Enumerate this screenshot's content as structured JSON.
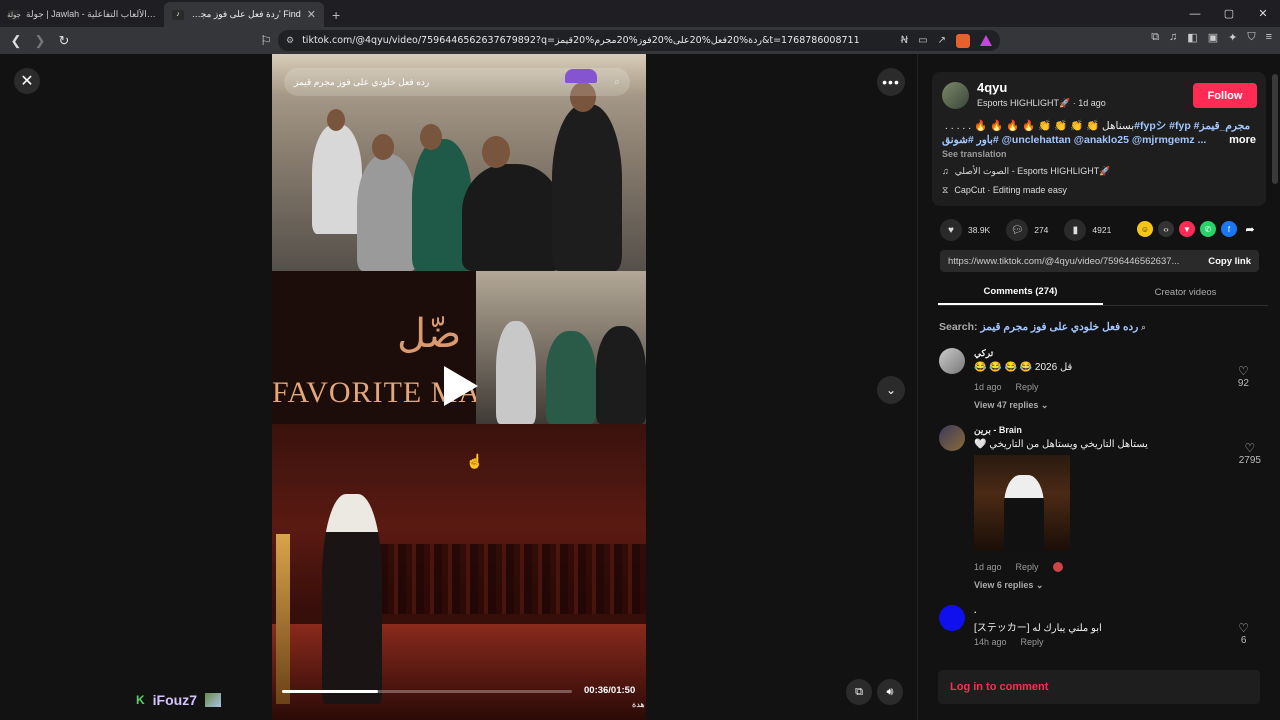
{
  "browser": {
    "tabs": [
      {
        "label": "جولة | Jawlah - منصة الألعاب التفاعلية",
        "favicon": "جولة"
      },
      {
        "label": "Find 'ردة فعل على فوز مجرم قيمز'",
        "favicon": "tiktok"
      }
    ],
    "new_tab": "+",
    "url": "tiktok.com/@4qyu/video/7596446562637679892?q=ردة%20فعل%20على%20فوز%20مجرم%20قيمز&t=1768786008711",
    "window_controls": [
      "—",
      "▢",
      "✕"
    ]
  },
  "video": {
    "search_text": "رده فعل خلودي على فوز مجرم قيمز",
    "banner_text": "FAVORITE MA",
    "banner_arabic": "ضّل",
    "current_time": "00:36",
    "duration": "01:50",
    "time_display": "00:36/01:50",
    "progress": 0.33,
    "corner_text": "هدة",
    "overlay_user": "iFouz7",
    "overlay_k": "K"
  },
  "author": {
    "username": "4qyu",
    "display": "Esports HIGHLIGHT🚀",
    "age": "· 1d ago",
    "follow_label": "Follow",
    "description_prefix": "بسناهل 👏 👏 👏 👏 🔥 🔥 🔥 🔥 . . . . . ",
    "description_tags": "#fypシ #fyp #مجرم_قيمز #باور #شونق @unclehattan @anaklo25 @mjrmgemz ...",
    "more_label": "more",
    "see_translation": "See translation",
    "music": "الصوت الأصلي - Esports HIGHLIGHT🚀",
    "capcut": "CapCut · Editing made easy"
  },
  "stats": {
    "likes": "38.9K",
    "comments": "274",
    "saves": "4921"
  },
  "share": {
    "link": "https://www.tiktok.com/@4qyu/video/7596446562637...",
    "copy_label": "Copy link"
  },
  "tabs": {
    "comments": "Comments (274)",
    "creator": "Creator videos"
  },
  "search": {
    "label": "Search:",
    "query": "رده فعل خلودي على فوز مجرم قيمز"
  },
  "comments": [
    {
      "name": "تركي",
      "text": "قل 2026 😂 😂 😂 😂",
      "age": "1d ago",
      "reply": "Reply",
      "likes": "92",
      "replies": "View 47 replies"
    },
    {
      "name": "برين - Brain",
      "text": "يستاهل التاريخي ويستاهل من التاريخي 🤍",
      "age": "1d ago",
      "reply": "Reply",
      "likes": "2795",
      "replies": "View 6 replies"
    },
    {
      "name": ".",
      "text": "[ステッカー] ابو ملني يبارك له",
      "age": "14h ago",
      "reply": "Reply",
      "likes": "6"
    }
  ],
  "login_label": "Log in to comment",
  "colors": {
    "accent": "#fe2c55",
    "link": "#a3c6ff",
    "panel": "#121212"
  }
}
